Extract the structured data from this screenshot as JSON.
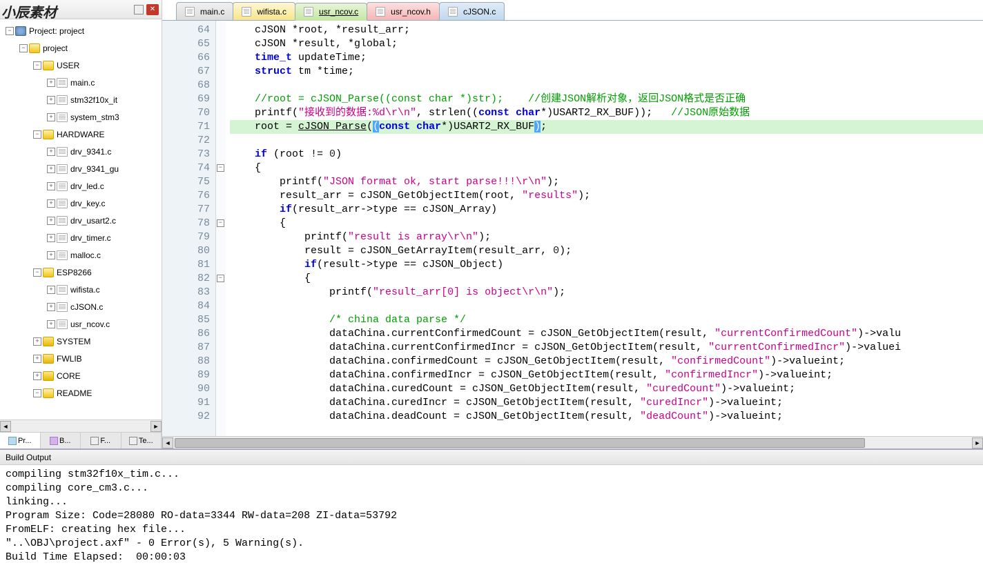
{
  "watermark": "小辰素材",
  "sidebar": {
    "project_root": "Project: project",
    "tabs": [
      {
        "label": "Pr..."
      },
      {
        "label": "B..."
      },
      {
        "label": "F..."
      },
      {
        "label": "Te..."
      }
    ]
  },
  "tree": [
    {
      "indent": 0,
      "exp": "-",
      "icon": "proj",
      "label": "Project: project"
    },
    {
      "indent": 1,
      "exp": "-",
      "icon": "folder",
      "label": "project"
    },
    {
      "indent": 2,
      "exp": "-",
      "icon": "folder",
      "label": "USER"
    },
    {
      "indent": 3,
      "exp": "+",
      "icon": "file",
      "label": "main.c"
    },
    {
      "indent": 3,
      "exp": "+",
      "icon": "file",
      "label": "stm32f10x_it"
    },
    {
      "indent": 3,
      "exp": "+",
      "icon": "file",
      "label": "system_stm3"
    },
    {
      "indent": 2,
      "exp": "-",
      "icon": "folder",
      "label": "HARDWARE"
    },
    {
      "indent": 3,
      "exp": "+",
      "icon": "file",
      "label": "drv_9341.c"
    },
    {
      "indent": 3,
      "exp": "+",
      "icon": "file",
      "label": "drv_9341_gu"
    },
    {
      "indent": 3,
      "exp": "+",
      "icon": "file",
      "label": "drv_led.c"
    },
    {
      "indent": 3,
      "exp": "+",
      "icon": "file",
      "label": "drv_key.c"
    },
    {
      "indent": 3,
      "exp": "+",
      "icon": "file",
      "label": "drv_usart2.c"
    },
    {
      "indent": 3,
      "exp": "+",
      "icon": "file",
      "label": "drv_timer.c"
    },
    {
      "indent": 3,
      "exp": "+",
      "icon": "file",
      "label": "malloc.c"
    },
    {
      "indent": 2,
      "exp": "-",
      "icon": "folder",
      "label": "ESP8266"
    },
    {
      "indent": 3,
      "exp": "+",
      "icon": "file",
      "label": "wifista.c"
    },
    {
      "indent": 3,
      "exp": "+",
      "icon": "file",
      "label": "cJSON.c"
    },
    {
      "indent": 3,
      "exp": "+",
      "icon": "file",
      "label": "usr_ncov.c"
    },
    {
      "indent": 2,
      "exp": "+",
      "icon": "folder-closed",
      "label": "SYSTEM"
    },
    {
      "indent": 2,
      "exp": "+",
      "icon": "folder-closed",
      "label": "FWLIB"
    },
    {
      "indent": 2,
      "exp": "+",
      "icon": "folder-closed",
      "label": "CORE"
    },
    {
      "indent": 2,
      "exp": "-",
      "icon": "folder",
      "label": "README"
    }
  ],
  "tabs": [
    {
      "label": "main.c",
      "cls": "tab-main"
    },
    {
      "label": "wifista.c",
      "cls": "tab-wifi"
    },
    {
      "label": "usr_ncov.c",
      "cls": "tab-usrc"
    },
    {
      "label": "usr_ncov.h",
      "cls": "tab-usrh"
    },
    {
      "label": "cJSON.c",
      "cls": "tab-cjson"
    }
  ],
  "line_start": 64,
  "line_end": 92,
  "fold_marks": [
    {
      "line": 74,
      "sym": "-"
    },
    {
      "line": 78,
      "sym": "-"
    },
    {
      "line": 82,
      "sym": "-"
    }
  ],
  "highlight_line": 71,
  "code": {
    "l64": {
      "pre": "    cJSON *root, *result_arr;"
    },
    "l65": {
      "pre": "    cJSON *result, *global;"
    },
    "l66": {
      "pre": "    time_t updateTime;",
      "kw": "time_t"
    },
    "l67": {
      "pre": "    struct tm *time;",
      "kw": "struct"
    },
    "l68": {
      "pre": ""
    },
    "l69": {
      "pre": "    //root = cJSON_Parse((const char *)str);    //创建JSON解析对象，返回JSON格式是否正确"
    },
    "l70": {
      "a": "    printf(",
      "s1": "\"接收到的数据:%d\\r\\n\"",
      "b": ", strlen((",
      "kw": "const char",
      "c": "*)USART2_RX_BUF));   ",
      "cm": "//JSON原始数据"
    },
    "l71": {
      "a": "    root = ",
      "fn": "cJSON_Parse",
      "b": "(",
      "sel": "(",
      "kw": "const char",
      "c": "*)USART2_RX_BUF",
      "sel2": ")",
      "d": ";"
    },
    "l72": {
      "pre": ""
    },
    "l73": {
      "a": "    ",
      "kw": "if",
      "b": " (root != ",
      "n": "0",
      "c": ")"
    },
    "l74": {
      "pre": "    {"
    },
    "l75": {
      "a": "        printf(",
      "s": "\"JSON format ok, start parse!!!\\r\\n\"",
      "b": ");"
    },
    "l76": {
      "a": "        result_arr = cJSON_GetObjectItem(root, ",
      "s": "\"results\"",
      "b": ");"
    },
    "l77": {
      "a": "        ",
      "kw": "if",
      "b": "(result_arr->type == cJSON_Array)"
    },
    "l78": {
      "pre": "        {"
    },
    "l79": {
      "a": "            printf(",
      "s": "\"result is array\\r\\n\"",
      "b": ");"
    },
    "l80": {
      "a": "            result = cJSON_GetArrayItem(result_arr, ",
      "n": "0",
      "b": ");"
    },
    "l81": {
      "a": "            ",
      "kw": "if",
      "b": "(result->type == cJSON_Object)"
    },
    "l82": {
      "pre": "            {"
    },
    "l83": {
      "a": "                printf(",
      "s": "\"result_arr[0] is object\\r\\n\"",
      "b": ");"
    },
    "l84": {
      "pre": ""
    },
    "l85": {
      "pre": "                /* china data parse */"
    },
    "l86": {
      "a": "                dataChina.currentConfirmedCount = cJSON_GetObjectItem(result, ",
      "s": "\"currentConfirmedCount\"",
      "b": ")->valu"
    },
    "l87": {
      "a": "                dataChina.currentConfirmedIncr = cJSON_GetObjectItem(result, ",
      "s": "\"currentConfirmedIncr\"",
      "b": ")->valuei"
    },
    "l88": {
      "a": "                dataChina.confirmedCount = cJSON_GetObjectItem(result, ",
      "s": "\"confirmedCount\"",
      "b": ")->valueint;"
    },
    "l89": {
      "a": "                dataChina.confirmedIncr = cJSON_GetObjectItem(result, ",
      "s": "\"confirmedIncr\"",
      "b": ")->valueint;"
    },
    "l90": {
      "a": "                dataChina.curedCount = cJSON_GetObjectItem(result, ",
      "s": "\"curedCount\"",
      "b": ")->valueint;"
    },
    "l91": {
      "a": "                dataChina.curedIncr = cJSON_GetObjectItem(result, ",
      "s": "\"curedIncr\"",
      "b": ")->valueint;"
    },
    "l92": {
      "a": "                dataChina.deadCount = cJSON_GetObjectItem(result, ",
      "s": "\"deadCount\"",
      "b": ")->valueint;"
    }
  },
  "build": {
    "title": "Build Output",
    "lines": [
      "compiling stm32f10x_tim.c...",
      "compiling core_cm3.c...",
      "linking...",
      "Program Size: Code=28080 RO-data=3344 RW-data=208 ZI-data=53792",
      "FromELF: creating hex file...",
      "\"..\\OBJ\\project.axf\" - 0 Error(s), 5 Warning(s).",
      "Build Time Elapsed:  00:00:03"
    ]
  }
}
